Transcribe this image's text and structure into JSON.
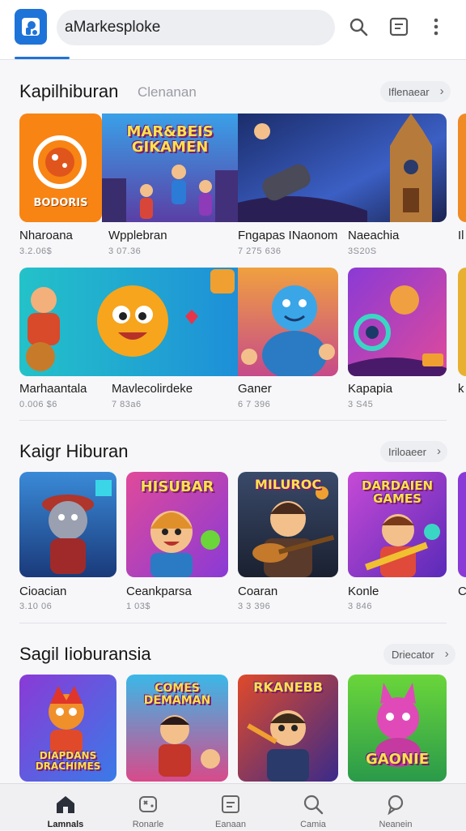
{
  "header": {
    "search_text": "aMarkesploke",
    "icons": [
      "app-logo-icon",
      "search-icon",
      "list-icon",
      "more-vert-icon"
    ],
    "accent": "#1e73d8"
  },
  "sections": [
    {
      "title": "Kapilhiburan",
      "subtitle": "Clenanan",
      "more_label": "Iflenaear",
      "rows": [
        [
          {
            "label": "Nharoana",
            "meta": "3.2.06$",
            "art_text": "BODORIS"
          },
          {
            "label": "Wpplebran",
            "meta": "3 07.36",
            "art_text": "MAR&BEIS GIKAMEN"
          },
          {
            "label": "Fngapas INaonom",
            "meta": "7 275 636",
            "art_text": ""
          },
          {
            "label": "Naeachia",
            "meta": "3S20S",
            "art_text": ""
          },
          {
            "label": "Il",
            "meta": "",
            "art_text": ""
          }
        ],
        [
          {
            "label": "Marhaantala",
            "meta": "0.006 $6",
            "art_text": ""
          },
          {
            "label": "Mavlecolirdeke",
            "meta": "7 83a6",
            "art_text": ""
          },
          {
            "label": "Ganer",
            "meta": "6 7 396",
            "art_text": ""
          },
          {
            "label": "Kapapia",
            "meta": "3 S45",
            "art_text": ""
          },
          {
            "label": "k",
            "meta": "",
            "art_text": ""
          }
        ]
      ]
    },
    {
      "title": "Kaigr Hiburan",
      "subtitle": "",
      "more_label": "Iriloaeer",
      "rows": [
        [
          {
            "label": "Cioacian",
            "meta": "3.10 06",
            "art_text": ""
          },
          {
            "label": "Ceankparsa",
            "meta": "1 03$",
            "art_text": "HISUBAR"
          },
          {
            "label": "Coaran",
            "meta": "3 3 396",
            "art_text": "MILUROC"
          },
          {
            "label": "Konle",
            "meta": "3 846",
            "art_text": "DARDAIEN GAMES"
          },
          {
            "label": "C",
            "meta": "",
            "art_text": ""
          }
        ]
      ]
    },
    {
      "title": "Sagil Iioburansia",
      "subtitle": "",
      "more_label": "Driecator",
      "rows": [
        [
          {
            "label": "",
            "meta": "",
            "art_text": "DIAPDANS DRACHIMES"
          },
          {
            "label": "",
            "meta": "",
            "art_text": "COMES DEMAMAN"
          },
          {
            "label": "",
            "meta": "",
            "art_text": "RKANEBB"
          },
          {
            "label": "",
            "meta": "",
            "art_text": "GAONIE"
          }
        ]
      ]
    }
  ],
  "bottom_nav": [
    {
      "label": "Lamnals",
      "icon": "home-icon",
      "active": true
    },
    {
      "label": "Ronarle",
      "icon": "gamepad-icon",
      "active": false
    },
    {
      "label": "Eanaan",
      "icon": "tablet-icon",
      "active": false
    },
    {
      "label": "Camia",
      "icon": "search-icon",
      "active": false
    },
    {
      "label": "Neanein",
      "icon": "chat-icon",
      "active": false
    }
  ]
}
